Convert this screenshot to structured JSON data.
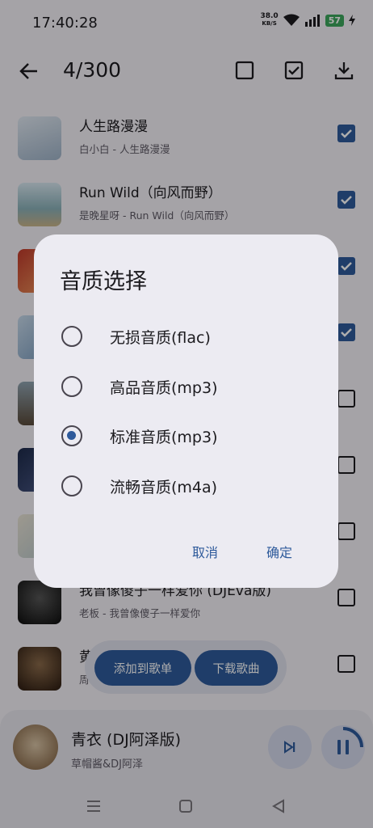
{
  "status": {
    "time": "17:40:28",
    "net_speed": "38.0",
    "net_unit": "KB/S",
    "battery": "57"
  },
  "appbar": {
    "count": "4/300"
  },
  "songs": [
    {
      "title": "人生路漫漫",
      "subtitle": "白小白 - 人生路漫漫",
      "checked": true
    },
    {
      "title": "Run Wild（向风而野）",
      "subtitle": "是晚星呀 - Run Wild（向风而野）",
      "checked": true
    },
    {
      "title": "",
      "subtitle": "",
      "checked": true
    },
    {
      "title": "",
      "subtitle": "",
      "checked": true
    },
    {
      "title": "",
      "subtitle": "",
      "checked": false
    },
    {
      "title": "",
      "subtitle": "",
      "checked": false
    },
    {
      "title": "",
      "subtitle": "",
      "checked": false
    },
    {
      "title": "我曾像傻子一样爱你 (DJEva版)",
      "subtitle": "老板 - 我曾像傻子一样爱你",
      "checked": false
    },
    {
      "title": "黄",
      "subtitle": "周",
      "checked": false
    }
  ],
  "actions": {
    "add_to_playlist": "添加到歌单",
    "download": "下载歌曲"
  },
  "player": {
    "title": "青衣 (DJ阿泽版)",
    "artist": "草帽酱&DJ阿泽"
  },
  "dialog": {
    "title": "音质选择",
    "options": [
      {
        "label": "无损音质(flac)",
        "selected": false
      },
      {
        "label": "高品音质(mp3)",
        "selected": false
      },
      {
        "label": "标准音质(mp3)",
        "selected": true
      },
      {
        "label": "流畅音质(m4a)",
        "selected": false
      }
    ],
    "cancel": "取消",
    "confirm": "确定"
  },
  "colors": {
    "accent": "#2e5a9b",
    "surface": "#f4f1f7",
    "dialog": "#ecebf2"
  }
}
